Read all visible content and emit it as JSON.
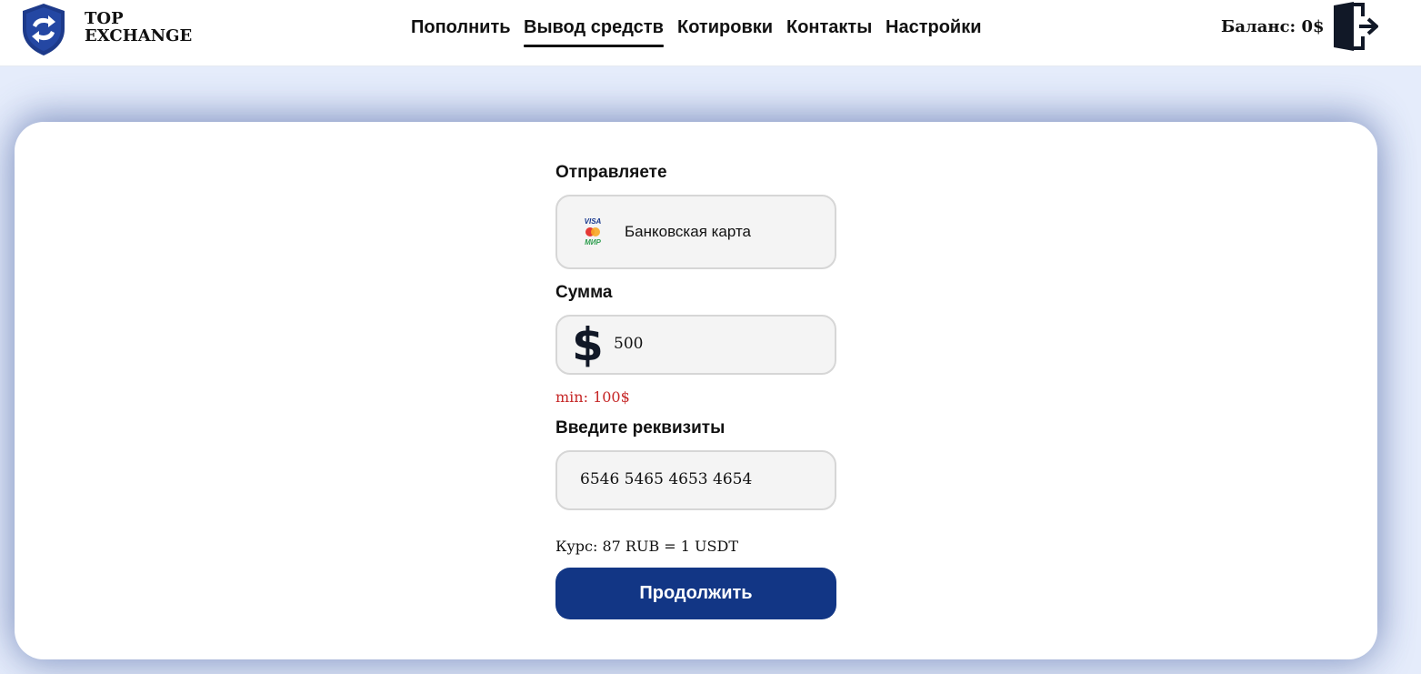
{
  "brand": {
    "line1": "TOP",
    "line2": "EXCHANGE",
    "icon": "shield-exchange-logo"
  },
  "nav": {
    "items": [
      {
        "label": "Пополнить",
        "active": false
      },
      {
        "label": "Вывод средств",
        "active": true
      },
      {
        "label": "Котировки",
        "active": false
      },
      {
        "label": "Контакты",
        "active": false
      },
      {
        "label": "Настройки",
        "active": false
      }
    ]
  },
  "header": {
    "balance": "Баланс: 0$",
    "exit_icon": "logout-door-icon"
  },
  "form": {
    "send_label": "Отправляете",
    "send_method": "Банковская карта",
    "send_method_icon": "visa-mastercard-mir-icon",
    "amount_label": "Сумма",
    "amount_icon": "dollar-icon",
    "amount_value": "500",
    "min_text": "min: 100$",
    "details_label": "Введите реквизиты",
    "details_value": "6546 5465 4653 4654",
    "rate_text": "Курс: 87 RUB = 1 USDT",
    "continue_label": "Продолжить"
  },
  "colors": {
    "page_bg": "#e5ecfb",
    "accent": "#123685",
    "error": "#c62828",
    "field_bg": "#f4f4f4"
  }
}
